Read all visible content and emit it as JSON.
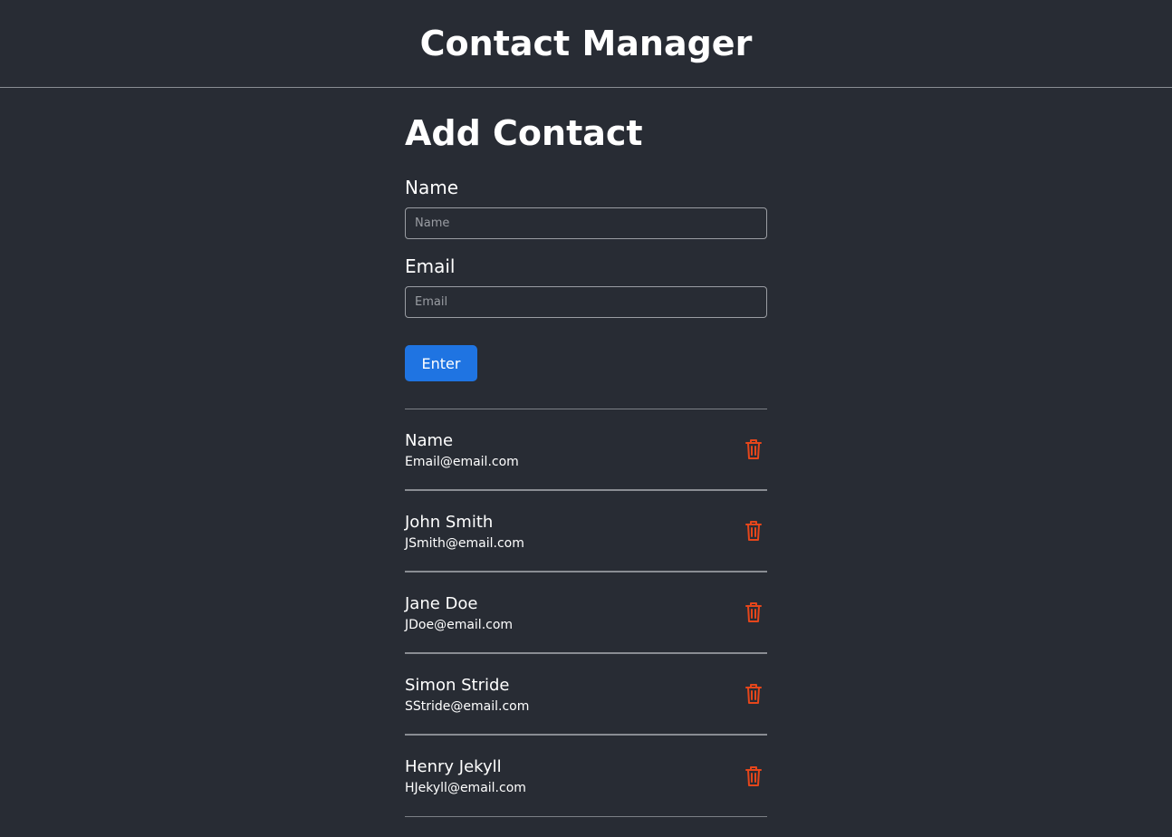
{
  "header": {
    "title": "Contact Manager"
  },
  "form": {
    "title": "Add Contact",
    "name_label": "Name",
    "name_placeholder": "Name",
    "name_value": "",
    "email_label": "Email",
    "email_placeholder": "Email",
    "email_value": "",
    "submit_label": "Enter"
  },
  "contacts": [
    {
      "name": "Name",
      "email": "Email@email.com"
    },
    {
      "name": "John Smith",
      "email": "JSmith@email.com"
    },
    {
      "name": "Jane Doe",
      "email": "JDoe@email.com"
    },
    {
      "name": "Simon Stride",
      "email": "SStride@email.com"
    },
    {
      "name": "Henry Jekyll",
      "email": "HJekyll@email.com"
    }
  ],
  "icons": {
    "delete": "trash-icon"
  },
  "colors": {
    "background": "#282c34",
    "accent": "#1f74e2",
    "delete": "#e5461b"
  }
}
